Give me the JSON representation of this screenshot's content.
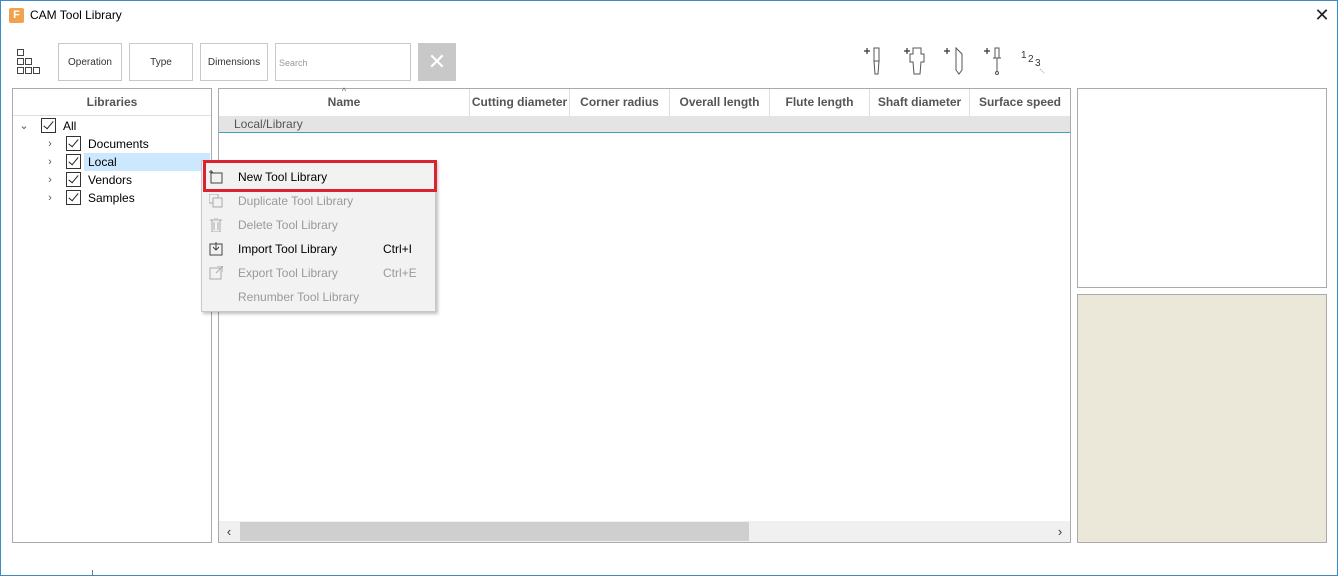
{
  "window": {
    "title": "CAM Tool Library",
    "app_icon_letter": "F",
    "close_glyph": "✕"
  },
  "toolbar": {
    "operation_label": "Operation",
    "type_label": "Type",
    "dimensions_label": "Dimensions",
    "search_placeholder": "Search",
    "clear_glyph": "✕",
    "tool_icons": [
      "add-endmill-icon",
      "add-holder-icon",
      "add-engrave-tool-icon",
      "add-probe-icon",
      "renumber-icon"
    ]
  },
  "libraries": {
    "header": "Libraries",
    "items": [
      {
        "label": "All",
        "expanded": true,
        "checked": true
      },
      {
        "label": "Documents",
        "expanded": false,
        "checked": true
      },
      {
        "label": "Local",
        "expanded": false,
        "checked": true,
        "selected": true
      },
      {
        "label": "Vendors",
        "expanded": false,
        "checked": true
      },
      {
        "label": "Samples",
        "expanded": false,
        "checked": true
      }
    ]
  },
  "table": {
    "columns": [
      "Name",
      "Cutting diameter",
      "Corner radius",
      "Overall length",
      "Flute length",
      "Shaft diameter",
      "Surface speed"
    ],
    "sort_glyph": "^",
    "group_row": "Local/Library"
  },
  "context_menu": {
    "items": [
      {
        "label": "New Tool Library",
        "shortcut": "",
        "enabled": true,
        "icon": "new-library-icon"
      },
      {
        "label": "Duplicate Tool Library",
        "shortcut": "",
        "enabled": false,
        "icon": "duplicate-icon"
      },
      {
        "label": "Delete Tool Library",
        "shortcut": "",
        "enabled": false,
        "icon": "trash-icon"
      },
      {
        "label": "Import Tool Library",
        "shortcut": "Ctrl+I",
        "enabled": true,
        "icon": "import-icon"
      },
      {
        "label": "Export Tool Library",
        "shortcut": "Ctrl+E",
        "enabled": false,
        "icon": "export-icon"
      },
      {
        "label": "Renumber Tool Library",
        "shortcut": "",
        "enabled": false,
        "icon": ""
      }
    ]
  },
  "colors": {
    "highlight_border": "#d9232e",
    "selection": "#cce8ff",
    "preview_bg": "#ebe8da",
    "group_underline": "#3aa3c4"
  }
}
